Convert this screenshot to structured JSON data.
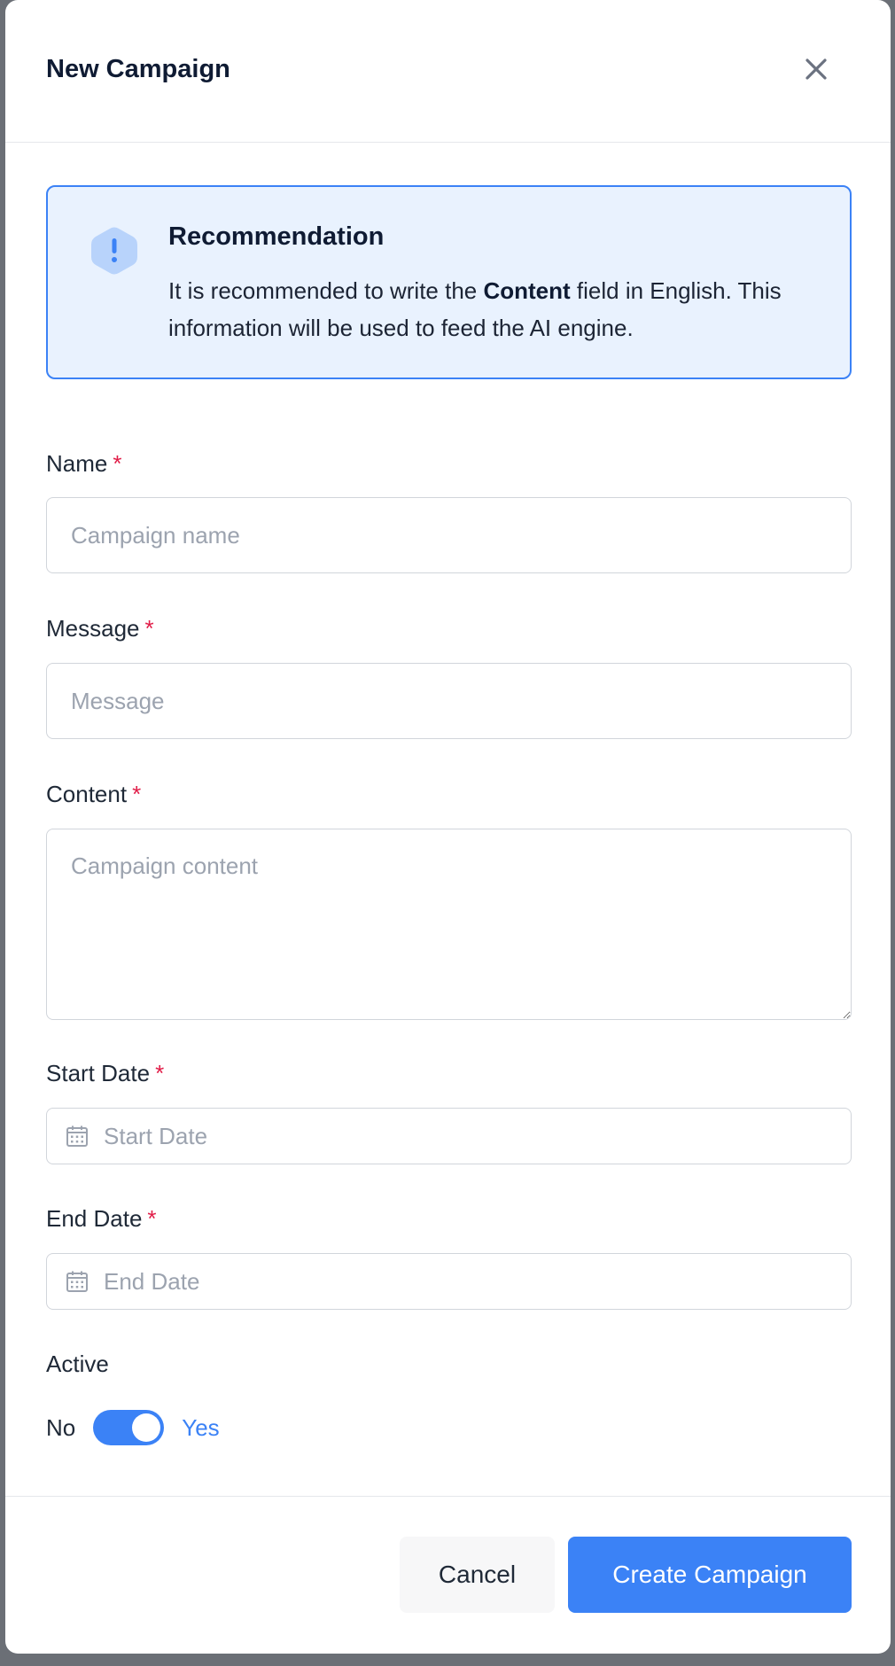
{
  "modal": {
    "title": "New Campaign",
    "close_icon": "close-icon"
  },
  "alert": {
    "icon": "exclamation-hexagon-icon",
    "title": "Recommendation",
    "text_prefix": "It is recommended to write the ",
    "text_bold": "Content",
    "text_suffix": " field in English. This information will be used to feed the AI engine."
  },
  "form": {
    "required_mark": "*",
    "name": {
      "label": "Name",
      "placeholder": "Campaign name",
      "value": ""
    },
    "message": {
      "label": "Message",
      "placeholder": "Message",
      "value": ""
    },
    "content": {
      "label": "Content",
      "placeholder": "Campaign content",
      "value": ""
    },
    "start_date": {
      "label": "Start Date",
      "placeholder": "Start Date",
      "value": "",
      "icon": "calendar-icon"
    },
    "end_date": {
      "label": "End Date",
      "placeholder": "End Date",
      "value": "",
      "icon": "calendar-icon"
    },
    "active": {
      "label": "Active",
      "off_label": "No",
      "on_label": "Yes",
      "state": "on"
    }
  },
  "footer": {
    "cancel_label": "Cancel",
    "submit_label": "Create Campaign"
  },
  "colors": {
    "primary": "#3b82f6",
    "alert_background": "#e9f2fe",
    "required": "#e11d48"
  }
}
